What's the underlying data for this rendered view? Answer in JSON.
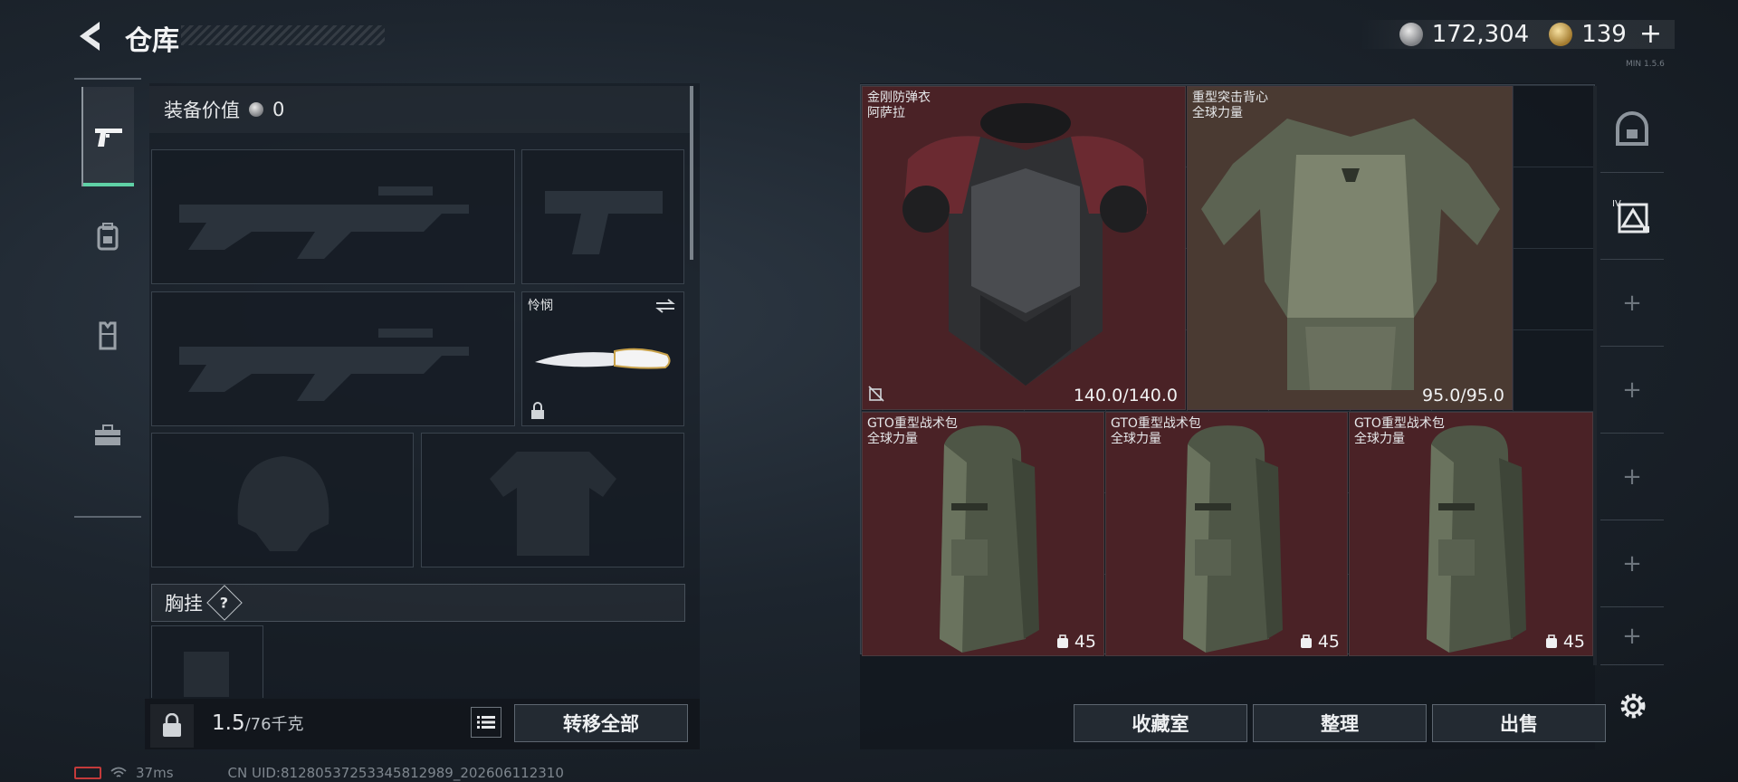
{
  "header": {
    "title": "仓库",
    "currency": [
      {
        "icon": "silver-coin-icon",
        "value": "172,304"
      },
      {
        "icon": "gold-coin-icon",
        "value": "139"
      }
    ],
    "plus": "+",
    "corner_text": "MIN 1.5.6"
  },
  "left_tabs": [
    {
      "icon": "pistol-icon",
      "active": true
    },
    {
      "icon": "backpack-icon",
      "active": false
    },
    {
      "icon": "vest-icon",
      "active": false
    },
    {
      "icon": "toolbox-icon",
      "active": false
    }
  ],
  "equipment": {
    "value_label": "装备价值",
    "value": "0",
    "melee_name": "怜悯",
    "chest_rig_label": "胸挂",
    "chest_rig_help": "?",
    "weight_current": "1.5",
    "weight_max": "/76千克",
    "transfer_all": "转移全部"
  },
  "storage": {
    "items": [
      {
        "name_line1": "金刚防弹衣",
        "name_line2": "阿萨拉",
        "value": "140.0/140.0"
      },
      {
        "name_line1": "重型突击背心",
        "name_line2": "全球力量",
        "value": "95.0/95.0"
      },
      {
        "name_line1": "GTO重型战术包",
        "name_line2": "全球力量",
        "count": "45"
      },
      {
        "name_line1": "GTO重型战术包",
        "name_line2": "全球力量",
        "count": "45"
      },
      {
        "name_line1": "GTO重型战术包",
        "name_line2": "全球力量",
        "count": "45"
      }
    ],
    "buttons": {
      "collection": "收藏室",
      "organize": "整理",
      "sell": "出售"
    },
    "side_tabs": [
      "safe-box-icon",
      "tier-four-icon",
      "+",
      "+",
      "+",
      "+",
      "+"
    ]
  },
  "status": {
    "ping": "37ms",
    "uid": "CN UID:8128053725334581​2989_202606112310"
  },
  "colors": {
    "accent": "#5fd1a6",
    "item_red": "#4a2226",
    "item_brown": "#4a3a32"
  }
}
